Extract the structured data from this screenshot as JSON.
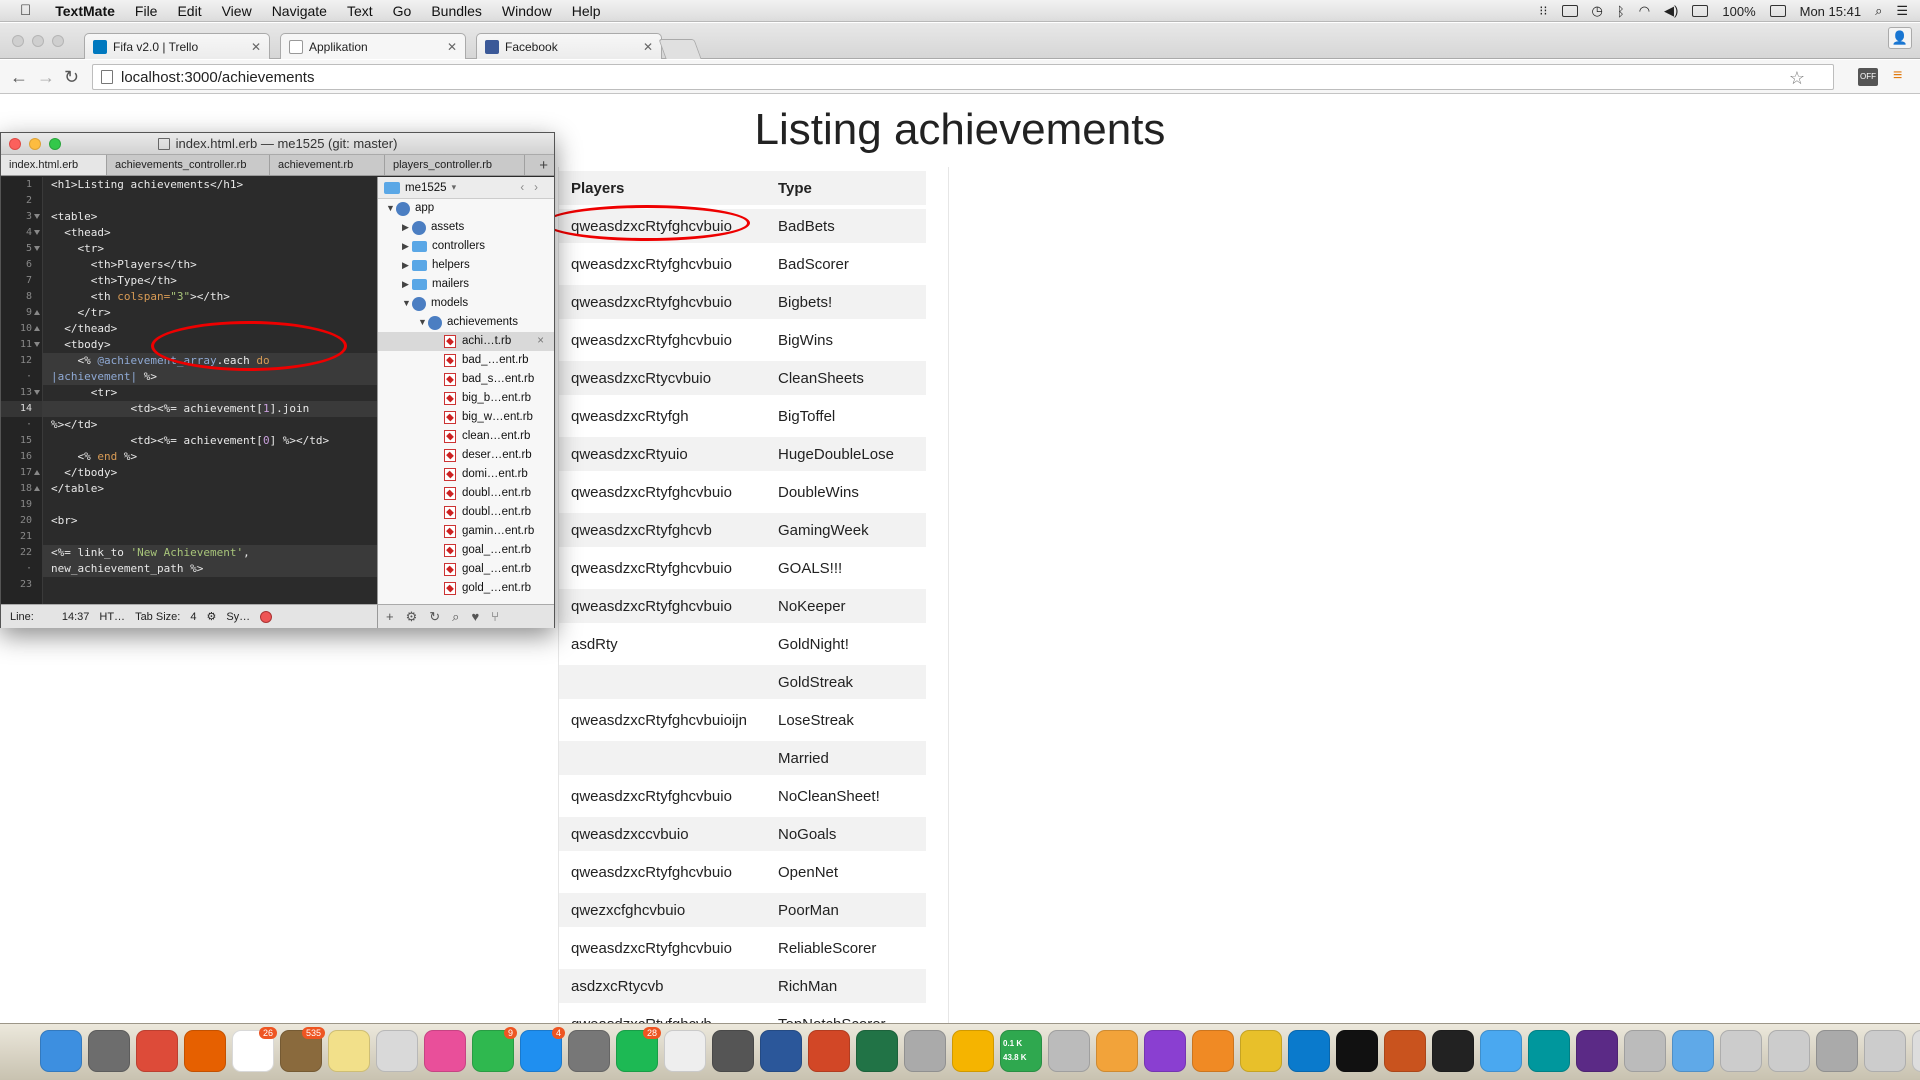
{
  "menubar": {
    "app_name": "TextMate",
    "menus": [
      "File",
      "Edit",
      "View",
      "Navigate",
      "Text",
      "Go",
      "Bundles",
      "Window",
      "Help"
    ],
    "battery": "100%",
    "clock": "Mon 15:41"
  },
  "browser": {
    "tabs": [
      {
        "title": "Fifa v2.0 | Trello",
        "icon": "trello-icon",
        "color": "#0079bf"
      },
      {
        "title": "Applikation",
        "icon": "page-icon",
        "color": "#ffffff"
      },
      {
        "title": "Facebook",
        "icon": "facebook-icon",
        "color": "#3b5998"
      }
    ],
    "url": "localhost:3000/achievements",
    "extension_badge": "OFF"
  },
  "page": {
    "title": "Listing achievements",
    "headers": {
      "players": "Players",
      "type": "Type"
    },
    "rows": [
      {
        "player": "qweasdzxcRtyfghcvbuio",
        "type": "BadBets"
      },
      {
        "player": "qweasdzxcRtyfghcvbuio",
        "type": "BadScorer"
      },
      {
        "player": "qweasdzxcRtyfghcvbuio",
        "type": "Bigbets!"
      },
      {
        "player": "qweasdzxcRtyfghcvbuio",
        "type": "BigWins"
      },
      {
        "player": "qweasdzxcRtycvbuio",
        "type": "CleanSheets"
      },
      {
        "player": "qweasdzxcRtyfgh",
        "type": "BigToffel"
      },
      {
        "player": "qweasdzxcRtyuio",
        "type": "HugeDoubleLose"
      },
      {
        "player": "qweasdzxcRtyfghcvbuio",
        "type": "DoubleWins"
      },
      {
        "player": "qweasdzxcRtyfghcvb",
        "type": "GamingWeek"
      },
      {
        "player": "qweasdzxcRtyfghcvbuio",
        "type": "GOALS!!!"
      },
      {
        "player": "qweasdzxcRtyfghcvbuio",
        "type": "NoKeeper"
      },
      {
        "player": "asdRty",
        "type": "GoldNight!"
      },
      {
        "player": "",
        "type": "GoldStreak"
      },
      {
        "player": "qweasdzxcRtyfghcvbuioijn",
        "type": "LoseStreak"
      },
      {
        "player": "",
        "type": "Married"
      },
      {
        "player": "qweasdzxcRtyfghcvbuio",
        "type": "NoCleanSheet!"
      },
      {
        "player": "qweasdzxccvbuio",
        "type": "NoGoals"
      },
      {
        "player": "qweasdzxcRtyfghcvbuio",
        "type": "OpenNet"
      },
      {
        "player": "qwezxcfghcvbuio",
        "type": "PoorMan"
      },
      {
        "player": "qweasdzxcRtyfghcvbuio",
        "type": "ReliableScorer"
      },
      {
        "player": "asdzxcRtycvb",
        "type": "RichMan"
      },
      {
        "player": "qweasdzxcRtyfghcvb",
        "type": "TopNotchScorer"
      }
    ]
  },
  "textmate": {
    "window_title": "index.html.erb — me1525 (git: master)",
    "tabs": [
      "index.html.erb",
      "achievements_controller.rb",
      "achievement.rb",
      "players_controller.rb"
    ],
    "line_numbers": [
      "1",
      "2",
      "3",
      "4",
      "5",
      "6",
      "7",
      "8",
      "9",
      "10",
      "11",
      "12",
      "·",
      "13",
      "14",
      "·",
      "15",
      "16",
      "17",
      "18",
      "19",
      "20",
      "21",
      "22",
      "·",
      "23"
    ],
    "code": {
      "l1a": "<h1>",
      "l1b": "Listing achievements",
      "l1c": "</h1>",
      "l3": "<table>",
      "l4": "  <thead>",
      "l5": "    <tr>",
      "l6a": "      <th>",
      "l6b": "Players",
      "l6c": "</th>",
      "l7a": "      <th>",
      "l7b": "Type",
      "l7c": "</th>",
      "l8a": "      <th ",
      "l8b": "colspan=",
      "l8c": "\"3\"",
      "l8d": "></th>",
      "l9": "    </tr>",
      "l10": "  </thead>",
      "l11": "  <tbody>",
      "l12a": "    <% ",
      "l12b": "@achievement_array",
      "l12c": ".each ",
      "l12d": "do",
      "l12e": "|achievement|",
      "l12f": " %>",
      "l13": "      <tr>",
      "l14a": "            <td><%= ",
      "l14b": "achievement[",
      "l14c": "1",
      "l14d": "].join",
      "l14e": "%></td>",
      "l15a": "            <td><%= ",
      "l15b": "achievement[",
      "l15c": "0",
      "l15d": "] %></td>",
      "l16a": "    <% ",
      "l16b": "end",
      "l16c": " %>",
      "l17": "  </tbody>",
      "l18": "</table>",
      "l20": "<br>",
      "l22a": "<%= link_to ",
      "l22b": "'New Achievement'",
      "l22c": ",",
      "l22d": "new_achievement_path %>"
    },
    "project": "me1525",
    "tree": {
      "app": "app",
      "assets": "assets",
      "controllers": "controllers",
      "helpers": "helpers",
      "mailers": "mailers",
      "models": "models",
      "achievements": "achievements",
      "files": [
        "achi…t.rb",
        "bad_…ent.rb",
        "bad_s…ent.rb",
        "big_b…ent.rb",
        "big_w…ent.rb",
        "clean…ent.rb",
        "deser…ent.rb",
        "domi…ent.rb",
        "doubl…ent.rb",
        "doubl…ent.rb",
        "gamin…ent.rb",
        "goal_…ent.rb",
        "goal_…ent.rb",
        "gold_…ent.rb"
      ]
    },
    "status": {
      "line_label": "Line:",
      "position": "14:37",
      "grammar": "HT…",
      "tab_size": "Tab Size:",
      "tab_value": "4",
      "symbol": "Sy…"
    }
  },
  "dock": {
    "apps": [
      "finder",
      "launchpad",
      "chrome",
      "firefox",
      "calendar",
      "preview",
      "notes",
      "photos",
      "photos-app",
      "facetime",
      "app-store",
      "system-preferences",
      "spotify",
      "textedit",
      "github",
      "word",
      "powerpoint",
      "excel",
      "unknown",
      "cloud",
      "monitor",
      "help",
      "sketch",
      "flower",
      "ibooks",
      "wunderlist",
      "vscode",
      "terminal",
      "firefox-dev",
      "activity-monitor",
      "messages",
      "arduino",
      "dashlane",
      "help2",
      "folder",
      "downloads",
      "documents",
      "screen",
      "screenshots",
      "trash"
    ],
    "badges": {
      "calendar": "26",
      "preview": "535",
      "facetime": "9",
      "app-store": "4",
      "spotify": "28"
    },
    "network": {
      "up": "0.1 K",
      "down": "43.8 K"
    }
  }
}
